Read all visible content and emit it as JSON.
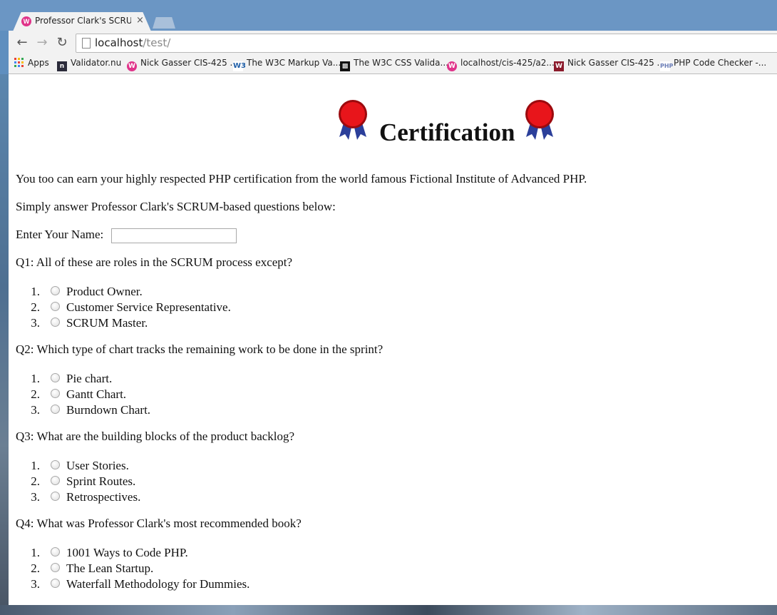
{
  "browser": {
    "tab_title": "Professor Clark's SCRUM C",
    "tab_close": "×",
    "url_host": "localhost",
    "url_path": "/test/",
    "back_icon": "arrow-left-icon",
    "forward_icon": "arrow-right-icon",
    "reload_icon": "reload-icon"
  },
  "bookmarks": [
    {
      "label": "Apps",
      "icon": "apps-grid-icon"
    },
    {
      "label": "Validator.nu",
      "icon": "validator-icon"
    },
    {
      "label": "Nick Gasser CIS-425 ...",
      "icon": "wamp-icon"
    },
    {
      "label": "The W3C Markup Va...",
      "icon": "w3c-icon"
    },
    {
      "label": "The W3C CSS Valida...",
      "icon": "puzzle-icon"
    },
    {
      "label": "localhost/cis-425/a2...",
      "icon": "wamp-icon"
    },
    {
      "label": "Nick Gasser CIS-425 ...",
      "icon": "w-icon"
    },
    {
      "label": "PHP Code Checker -...",
      "icon": "php-icon"
    }
  ],
  "page": {
    "heading": "Certification",
    "intro": "You too can earn your highly respected PHP certification from the world famous Fictional Institute of Advanced PHP.",
    "instructions": "Simply answer Professor Clark's SCRUM-based questions below:",
    "name_label": "Enter Your Name:",
    "name_value": "",
    "questions": [
      {
        "text": "Q1: All of these are roles in the SCRUM process except?",
        "options": [
          "Product Owner.",
          "Customer Service Representative.",
          "SCRUM Master."
        ]
      },
      {
        "text": "Q2: Which type of chart tracks the remaining work to be done in the sprint?",
        "options": [
          "Pie chart.",
          "Gantt Chart.",
          "Burndown Chart."
        ]
      },
      {
        "text": "Q3: What are the building blocks of the product backlog?",
        "options": [
          "User Stories.",
          "Sprint Routes.",
          "Retrospectives."
        ]
      },
      {
        "text": "Q4: What was Professor Clark's most recommended book?",
        "options": [
          "1001 Ways to Code PHP.",
          "The Lean Startup.",
          "Waterfall Methodology for Dummies."
        ]
      }
    ],
    "option_numbers": [
      "1.",
      "2.",
      "3."
    ]
  },
  "colors": {
    "ribbon_red": "#e8151b",
    "ribbon_blue": "#2b3f9a",
    "wamp_pink": "#e0348a",
    "w3c_blue": "#1f5fa8"
  }
}
